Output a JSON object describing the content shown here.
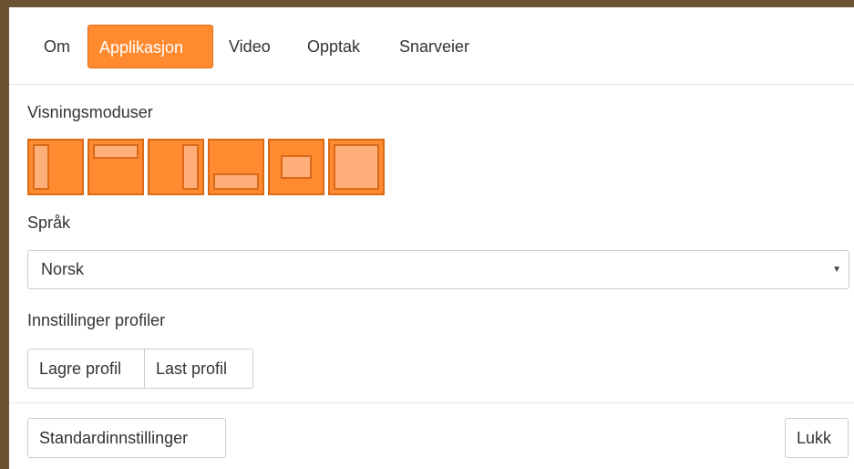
{
  "tabs": [
    {
      "label": "Om",
      "active": false
    },
    {
      "label": "Applikasjon",
      "active": true
    },
    {
      "label": "Video",
      "active": false
    },
    {
      "label": "Opptak",
      "active": false
    },
    {
      "label": "Snarveier",
      "active": false
    }
  ],
  "view_modes": {
    "label": "Visningsmoduser",
    "modes": [
      "left-panel",
      "top-panel",
      "right-panel",
      "bottom-panel",
      "center-panel",
      "full-panel"
    ]
  },
  "language": {
    "label": "Språk",
    "selected": "Norsk"
  },
  "profiles": {
    "label": "Innstillinger profiler",
    "save_label": "Lagre profil",
    "load_label": "Last profil"
  },
  "footer": {
    "defaults_label": "Standardinnstillinger",
    "close_label": "Lukk"
  },
  "colors": {
    "accent": "#ff8a30",
    "accent_border": "#d86a18",
    "accent_light": "#ffb07a"
  }
}
